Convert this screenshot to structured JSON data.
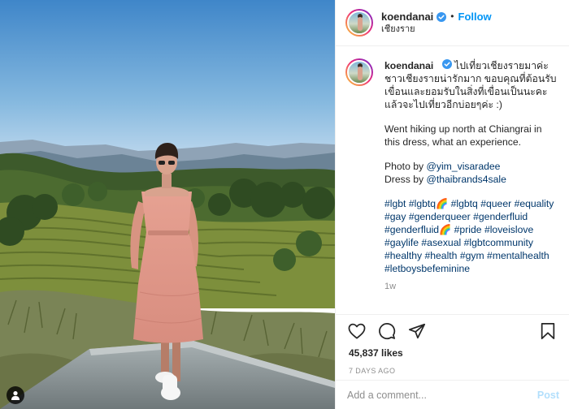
{
  "post": {
    "image_alt": "Person in a pink off-shoulder dress standing on a ledge above hillside tea plantations with mountains and blue sky"
  },
  "header": {
    "username": "koendanai",
    "separator": "•",
    "follow_label": "Follow",
    "location": "เชียงราย",
    "verified": true
  },
  "caption": {
    "username": "koendanai",
    "thai_text": "ไปเที่ยวเชียงรายมาค่ะ ชาวเชียงรายน่ารักมาก ขอบคุณที่ต้อนรับเขื่อนและยอมรับในสิ่งที่เขื่อนเป็นนะคะ แล้วจะไปเที่ยวอีกบ่อยๆค่ะ :)",
    "english_text": "Went hiking up north at Chiangrai in this dress, what an experience.",
    "photo_by_label": "Photo by",
    "photo_by": "@yim_visaradee",
    "dress_by_label": "Dress by",
    "dress_by": "@thaibrands4sale",
    "hashtags": [
      "#lgbt",
      "#lgbtq🌈",
      "#lgbtq",
      "#queer",
      "#equality",
      "#gay",
      "#genderqueer",
      "#genderfluid",
      "#genderfluid🌈",
      "#pride",
      "#loveislove",
      "#gaylife",
      "#asexual",
      "#lgbtcommunity",
      "#healthy",
      "#health",
      "#gym",
      "#mentalhealth",
      "#letboysbefeminine"
    ],
    "time_ago": "1w"
  },
  "actions": {
    "like_icon": "heart-icon",
    "comment_icon": "comment-bubble-icon",
    "share_icon": "paper-plane-icon",
    "save_icon": "bookmark-icon"
  },
  "likes": "45,837 likes",
  "date": "7 DAYS AGO",
  "comment_box": {
    "placeholder": "Add a comment...",
    "post_label": "Post"
  },
  "colors": {
    "link_blue": "#0095f6",
    "hashtag_blue": "#00376b",
    "muted": "#8e8e8e",
    "border": "#efefef"
  }
}
